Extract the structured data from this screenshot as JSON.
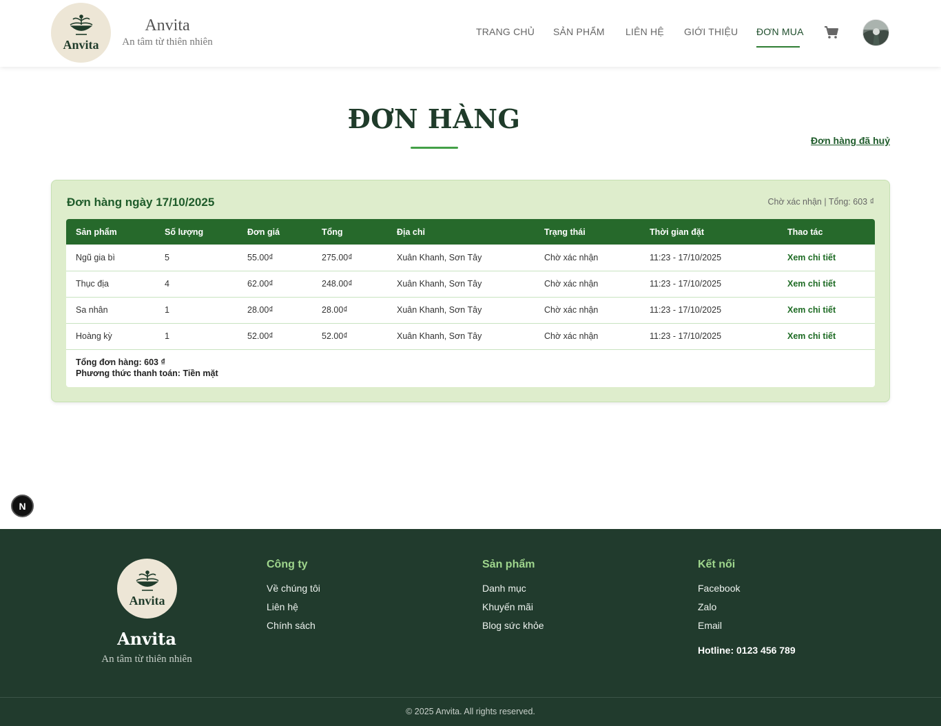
{
  "header": {
    "logo_text": "Anvita",
    "brand_name": "Anvita",
    "tagline": "An tâm từ thiên nhiên",
    "nav": [
      {
        "label": "TRANG CHỦ"
      },
      {
        "label": "SẢN PHẨM"
      },
      {
        "label": "LIÊN HỆ"
      },
      {
        "label": "GIỚI THIỆU"
      },
      {
        "label": "ĐƠN MUA"
      }
    ],
    "cart_icon": "shopping-cart-icon",
    "avatar_icon": "user-avatar"
  },
  "page": {
    "title": "ĐƠN HÀNG",
    "cancelled_link": "Đơn hàng đã huỷ"
  },
  "order": {
    "title": "Đơn hàng ngày 17/10/2025",
    "status_summary": "Chờ xác nhận | Tổng: 603 ₫",
    "columns": [
      "Sản phẩm",
      "Số lượng",
      "Đơn giá",
      "Tổng",
      "Địa chỉ",
      "Trạng thái",
      "Thời gian đặt",
      "Thao tác"
    ],
    "rows": [
      [
        "Ngũ gia bì",
        "5",
        "55.00₫",
        "275.00₫",
        "Xuân Khanh, Sơn Tây",
        "Chờ xác nhận",
        "11:23 - 17/10/2025",
        "Xem chi tiết"
      ],
      [
        "Thục địa",
        "4",
        "62.00₫",
        "248.00₫",
        "Xuân Khanh, Sơn Tây",
        "Chờ xác nhận",
        "11:23 - 17/10/2025",
        "Xem chi tiết"
      ],
      [
        "Sa nhân",
        "1",
        "28.00₫",
        "28.00₫",
        "Xuân Khanh, Sơn Tây",
        "Chờ xác nhận",
        "11:23 - 17/10/2025",
        "Xem chi tiết"
      ],
      [
        "Hoàng kỳ",
        "1",
        "52.00₫",
        "52.00₫",
        "Xuân Khanh, Sơn Tây",
        "Chờ xác nhận",
        "11:23 - 17/10/2025",
        "Xem chi tiết"
      ]
    ],
    "total_line": "Tổng đơn hàng: 603 ₫",
    "payment_line": "Phương thức thanh toán: Tiền mặt"
  },
  "badge": {
    "label": "N"
  },
  "footer": {
    "logo_text": "Anvita",
    "brand_name": "Anvita",
    "tagline": "An tâm từ thiên nhiên",
    "company": {
      "title": "Công ty",
      "links": [
        "Về chúng tôi",
        "Liên hệ",
        "Chính sách"
      ]
    },
    "products": {
      "title": "Sản phẩm",
      "links": [
        "Danh mục",
        "Khuyến mãi",
        "Blog sức khỏe"
      ]
    },
    "connect": {
      "title": "Kết nối",
      "links": [
        "Facebook",
        "Zalo",
        "Email"
      ]
    },
    "hotline": "Hotline: 0123 456 789",
    "copyright": "© 2025 Anvita. All rights reserved."
  },
  "colors": {
    "primary_green": "#26692b",
    "dark_green": "#1e5b2a",
    "footer_bg": "#213b2d",
    "card_bg": "#deedcc",
    "logo_bg": "#ede6d6"
  }
}
